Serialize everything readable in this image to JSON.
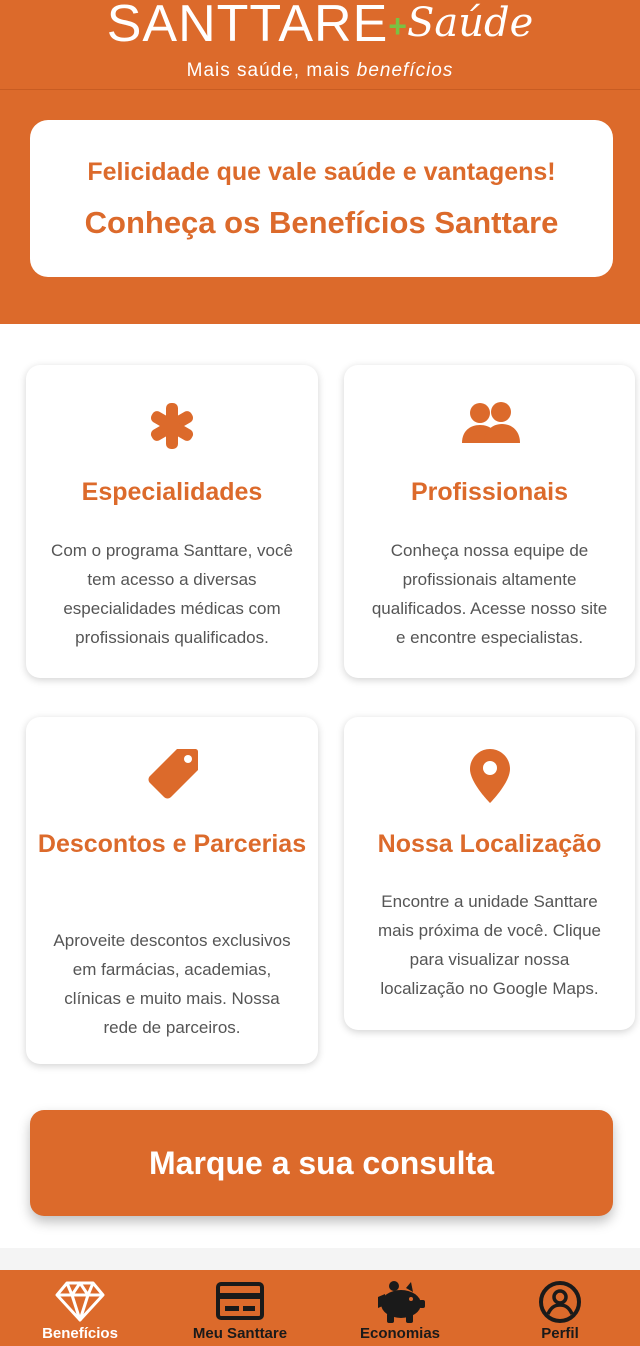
{
  "header": {
    "logo_main": "SANTTARE",
    "logo_plus": "+",
    "logo_script": "Saúde",
    "tagline_plain": "Mais saúde, mais ",
    "tagline_italic": "benefícios"
  },
  "hero": {
    "line1": "Felicidade que vale saúde e vantagens!",
    "line2": "Conheça os Benefícios Santtare"
  },
  "cards": [
    {
      "icon": "asterisk-icon",
      "title": "Especialidades",
      "desc": "Com o programa Santtare, você tem acesso a diversas especialidades médicas com profissionais qualificados."
    },
    {
      "icon": "users-icon",
      "title": "Profissionais",
      "desc": "Conheça nossa equipe de profissionais altamente qualificados. Acesse nosso site e encontre especialistas."
    },
    {
      "icon": "tag-icon",
      "title": "Descontos e Parcerias",
      "desc": "Aproveite descontos exclusivos em farmácias, academias, clínicas e muito mais. Nossa rede de parceiros."
    },
    {
      "icon": "map-pin-icon",
      "title": "Nossa Localização",
      "desc": "Encontre a unidade Santtare mais próxima de você. Clique para visualizar nossa localização no Google Maps."
    }
  ],
  "cta": {
    "label": "Marque a sua consulta"
  },
  "bottom_nav": [
    {
      "label": "Benefícios",
      "icon": "diamond-icon",
      "active": true
    },
    {
      "label": "Meu Santtare",
      "icon": "card-icon",
      "active": false
    },
    {
      "label": "Economias",
      "icon": "piggy-bank-icon",
      "active": false
    },
    {
      "label": "Perfil",
      "icon": "user-circle-icon",
      "active": false
    }
  ],
  "colors": {
    "brand": "#dc6a2b",
    "logo_plus": "#7ac143",
    "text_muted": "#555555",
    "nav_label": "#1a1a1a"
  }
}
